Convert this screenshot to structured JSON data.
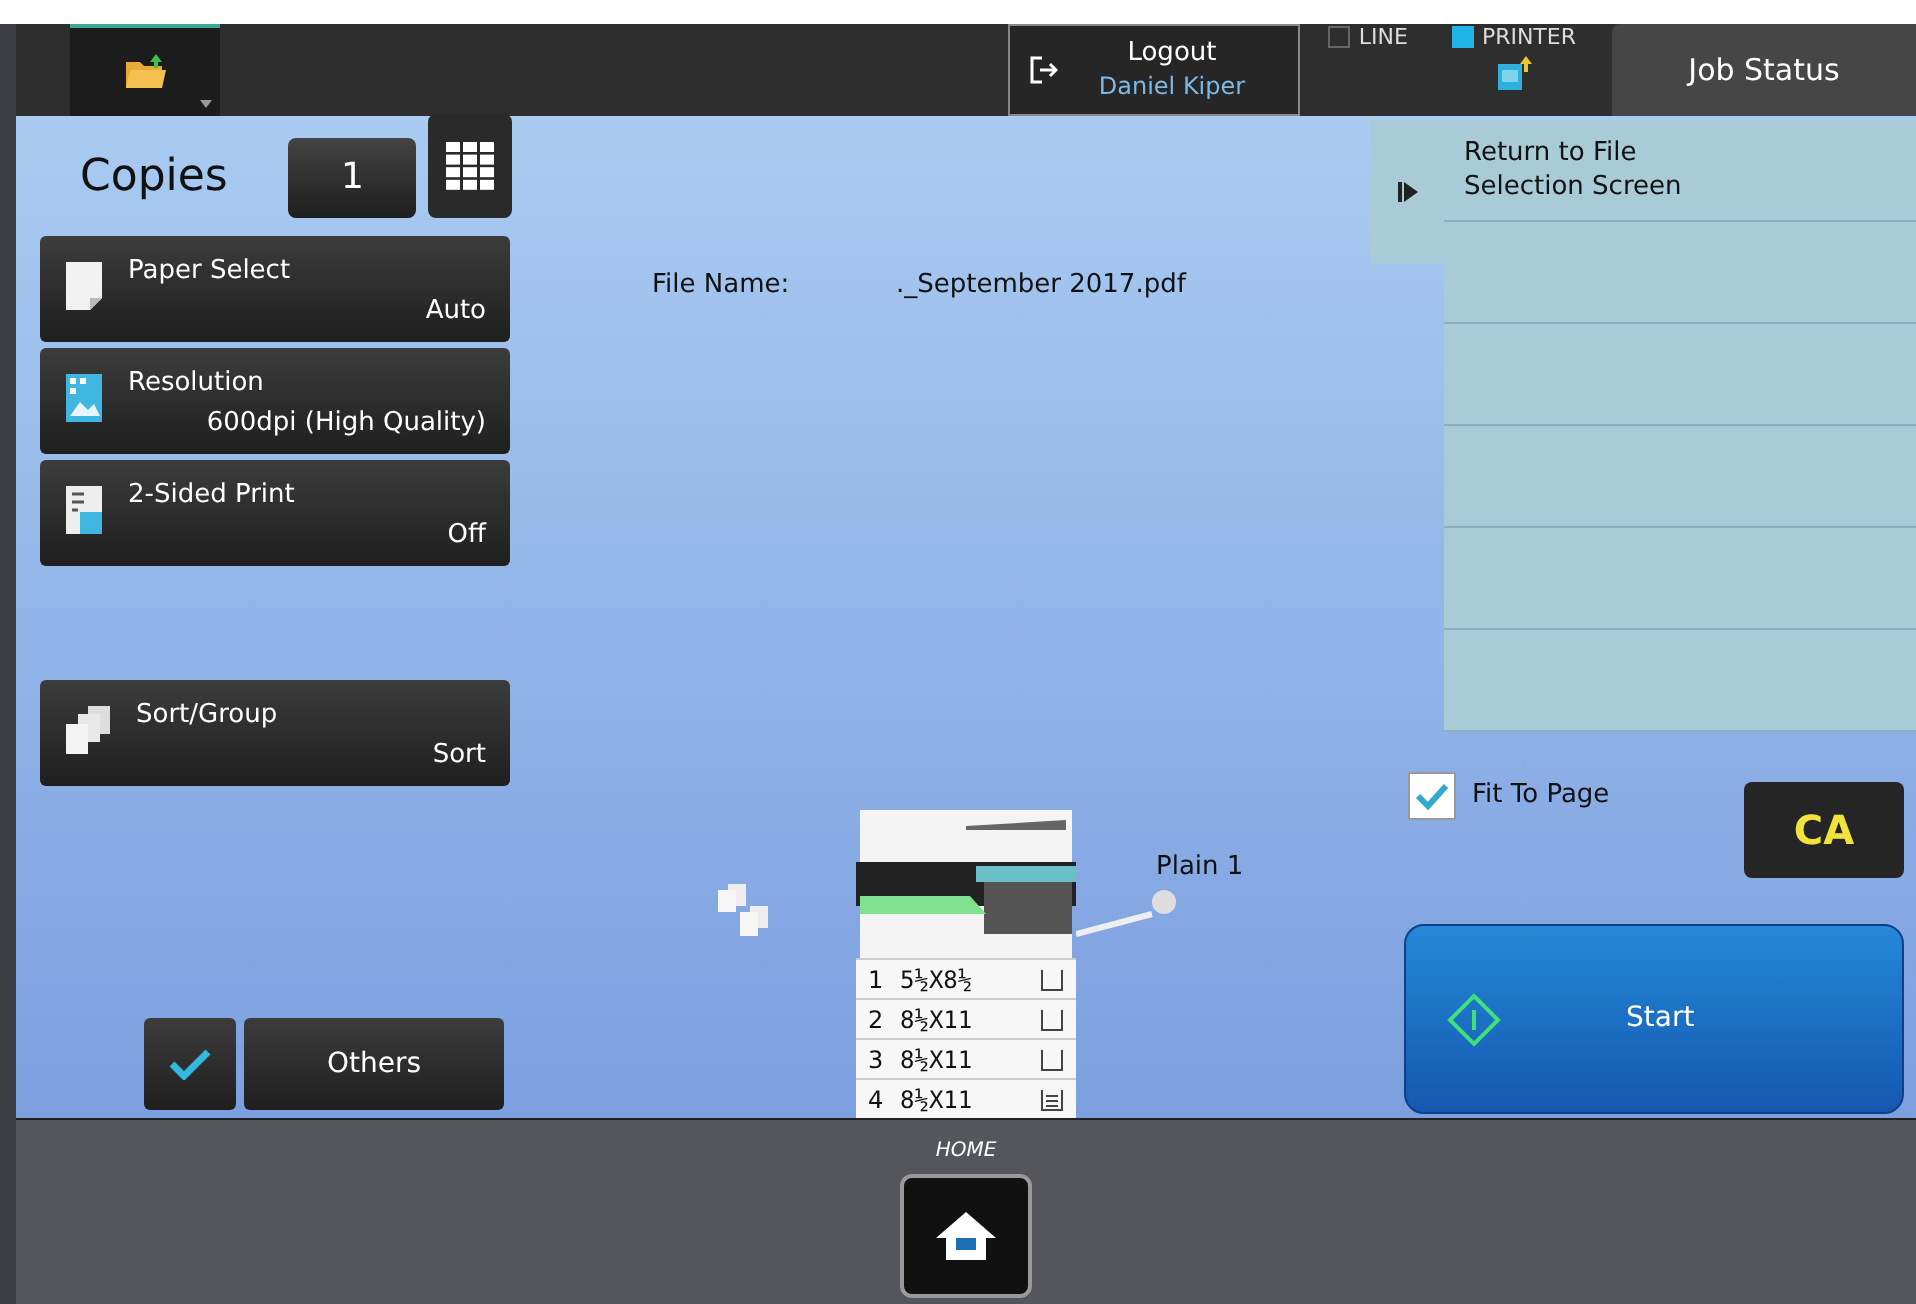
{
  "top_bar": {
    "logout": {
      "label": "Logout",
      "user": "Daniel Kiper"
    },
    "indicators": [
      {
        "label": "LINE",
        "on": false
      },
      {
        "label": "PRINTER",
        "on": true
      }
    ],
    "job_status": "Job Status"
  },
  "copies": {
    "label": "Copies",
    "value": "1"
  },
  "settings": [
    {
      "name": "Paper Select",
      "value": "Auto",
      "kind": "paper"
    },
    {
      "name": "Resolution",
      "value": "600dpi (High Quality)",
      "kind": "resolution"
    },
    {
      "name": "2-Sided Print",
      "value": "Off",
      "kind": "duplex"
    },
    {
      "name": "Sort/Group",
      "value": "Sort",
      "kind": "sort"
    }
  ],
  "file": {
    "label": "File Name:",
    "value": "._September 2017.pdf"
  },
  "side_panel": {
    "items": [
      "Return to File Selection Screen"
    ]
  },
  "paper_tray": {
    "output_label": "Plain 1",
    "trays": [
      {
        "number": "1",
        "size": "5½X8½",
        "loaded": false
      },
      {
        "number": "2",
        "size": "8½X11",
        "loaded": false
      },
      {
        "number": "3",
        "size": "8½X11",
        "loaded": false
      },
      {
        "number": "4",
        "size": "8½X11",
        "loaded": true
      }
    ]
  },
  "fit_to_page": {
    "label": "Fit To Page",
    "checked": true
  },
  "clear_all": "CA",
  "start": "Start",
  "others": "Others",
  "home": {
    "label": "HOME"
  }
}
